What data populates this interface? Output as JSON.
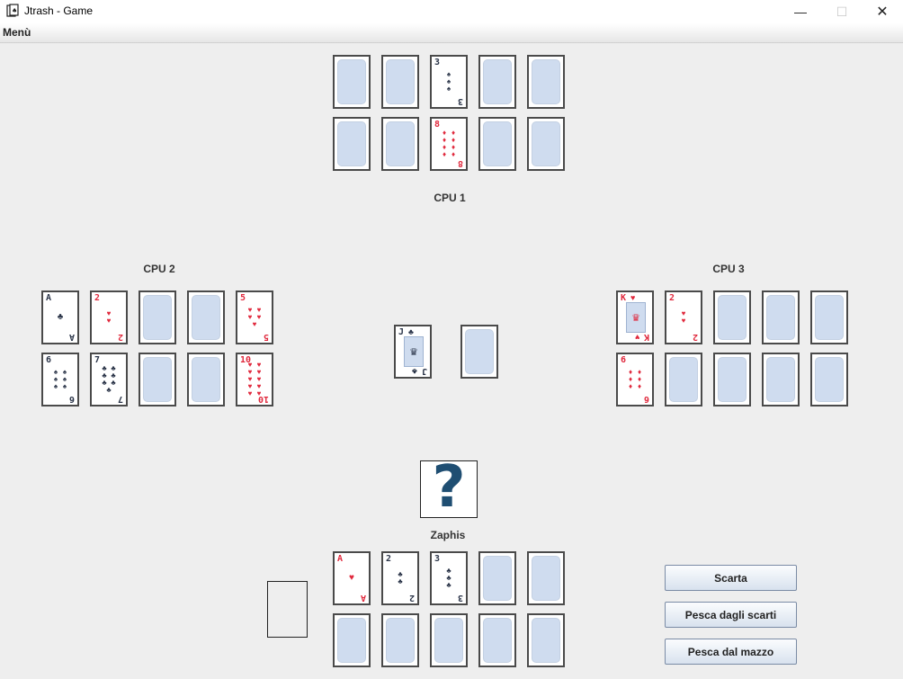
{
  "window": {
    "title": "Jtrash - Game",
    "controls": {
      "minimize": "—",
      "maximize": "☐",
      "close": "✕"
    }
  },
  "menubar": {
    "menu_label": "Menù"
  },
  "players": {
    "cpu1": {
      "name": "CPU 1"
    },
    "cpu2": {
      "name": "CPU 2"
    },
    "cpu3": {
      "name": "CPU 3"
    },
    "human": {
      "name": "Zaphis"
    }
  },
  "cards": {
    "cpu1": [
      {
        "rank": "",
        "suit": "",
        "color": "back"
      },
      {
        "rank": "",
        "suit": "",
        "color": "back"
      },
      {
        "rank": "3",
        "suit": "♠",
        "color": "black"
      },
      {
        "rank": "",
        "suit": "",
        "color": "back"
      },
      {
        "rank": "",
        "suit": "",
        "color": "back"
      },
      {
        "rank": "",
        "suit": "",
        "color": "back"
      },
      {
        "rank": "",
        "suit": "",
        "color": "back"
      },
      {
        "rank": "8",
        "suit": "♦",
        "color": "red"
      },
      {
        "rank": "",
        "suit": "",
        "color": "back"
      },
      {
        "rank": "",
        "suit": "",
        "color": "back"
      }
    ],
    "cpu2": [
      {
        "rank": "A",
        "suit": "♣",
        "color": "black"
      },
      {
        "rank": "2",
        "suit": "♥",
        "color": "red"
      },
      {
        "rank": "",
        "suit": "",
        "color": "back"
      },
      {
        "rank": "",
        "suit": "",
        "color": "back"
      },
      {
        "rank": "5",
        "suit": "♥",
        "color": "red"
      },
      {
        "rank": "6",
        "suit": "♠",
        "color": "black"
      },
      {
        "rank": "7",
        "suit": "♣",
        "color": "black"
      },
      {
        "rank": "",
        "suit": "",
        "color": "back"
      },
      {
        "rank": "",
        "suit": "",
        "color": "back"
      },
      {
        "rank": "10",
        "suit": "♥",
        "color": "red"
      }
    ],
    "cpu3": [
      {
        "rank": "K",
        "suit": "♥",
        "color": "red"
      },
      {
        "rank": "2",
        "suit": "♥",
        "color": "red"
      },
      {
        "rank": "",
        "suit": "",
        "color": "back"
      },
      {
        "rank": "",
        "suit": "",
        "color": "back"
      },
      {
        "rank": "",
        "suit": "",
        "color": "back"
      },
      {
        "rank": "6",
        "suit": "♦",
        "color": "red"
      },
      {
        "rank": "",
        "suit": "",
        "color": "back"
      },
      {
        "rank": "",
        "suit": "",
        "color": "back"
      },
      {
        "rank": "",
        "suit": "",
        "color": "back"
      },
      {
        "rank": "",
        "suit": "",
        "color": "back"
      }
    ],
    "human": [
      {
        "rank": "A",
        "suit": "♥",
        "color": "red"
      },
      {
        "rank": "2",
        "suit": "♣",
        "color": "black"
      },
      {
        "rank": "3",
        "suit": "♣",
        "color": "black"
      },
      {
        "rank": "",
        "suit": "",
        "color": "back"
      },
      {
        "rank": "",
        "suit": "",
        "color": "back"
      },
      {
        "rank": "",
        "suit": "",
        "color": "back"
      },
      {
        "rank": "",
        "suit": "",
        "color": "back"
      },
      {
        "rank": "",
        "suit": "",
        "color": "back"
      },
      {
        "rank": "",
        "suit": "",
        "color": "back"
      },
      {
        "rank": "",
        "suit": "",
        "color": "back"
      }
    ],
    "discard_pile": {
      "rank": "J",
      "suit": "♣",
      "color": "black"
    },
    "draw_deck": {
      "rank": "",
      "suit": "",
      "color": "back"
    }
  },
  "actions": {
    "discard": "Scarta",
    "draw_from_discards": "Pesca dagli scarti",
    "draw_from_deck": "Pesca dal mazzo"
  }
}
